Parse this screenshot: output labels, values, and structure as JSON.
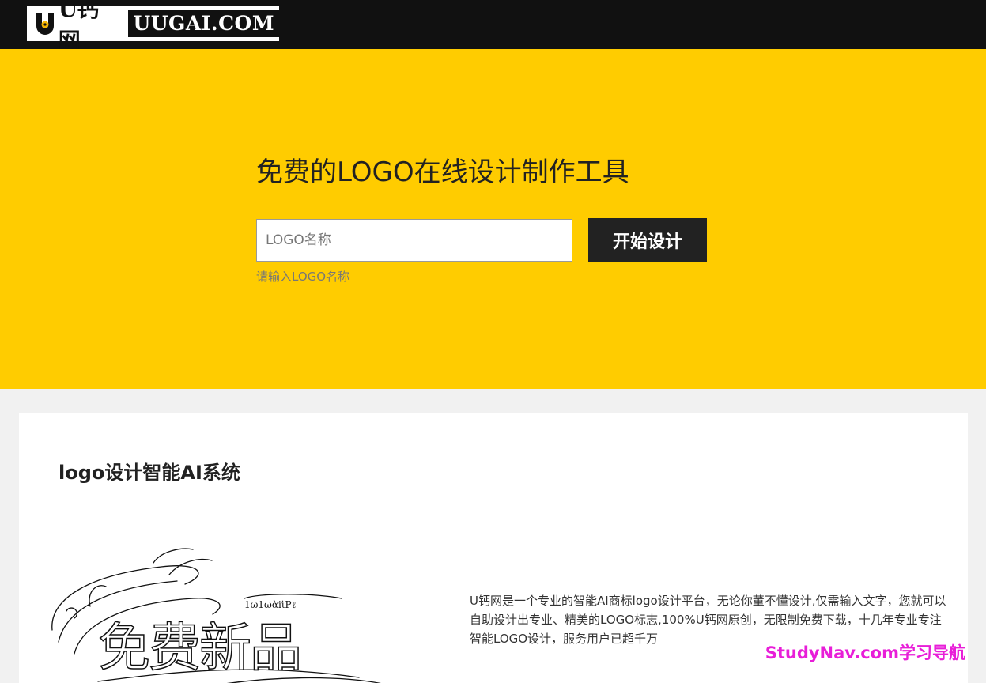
{
  "header": {
    "logo_cn": "U钙网",
    "logo_en": "UUGAI.COM"
  },
  "hero": {
    "title": "免费的LOGO在线设计制作工具",
    "input_placeholder": "LOGO名称",
    "button_label": "开始设计",
    "hint": "请输入LOGO名称"
  },
  "section": {
    "title": "logo设计智能AI系统",
    "image_text": "免费新品",
    "description": "U钙网是一个专业的智能AI商标logo设计平台，无论你董不懂设计,仅需输入文字，您就可以自助设计出专业、精美的LOGO标志,100%U钙网原创，无限制免费下载，十几年专业专注智能LOGO设计，服务用户已超千万"
  },
  "watermark": "StudyNav.com学习导航",
  "colors": {
    "brand_yellow": "#ffcc00",
    "topbar": "#111111",
    "button": "#222222",
    "watermark": "#e81ed8"
  }
}
